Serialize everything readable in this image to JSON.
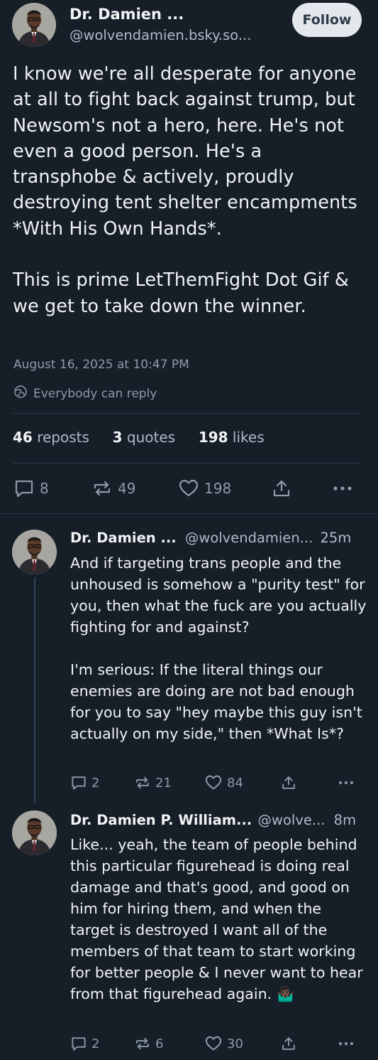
{
  "main_post": {
    "author_name": "Dr. Damien ...",
    "author_handle": "@wolvendamien.bsky.so...",
    "follow_label": "Follow",
    "text": "I know we're all desperate for anyone at all to fight back against trump, but Newsom's not a hero, here. He's not even a good person. He's a transphobe & actively, proudly destroying tent shelter encampments *With His Own Hands*.\n\nThis is prime LetThemFight Dot Gif & we get to take down the winner.",
    "timestamp": "August 16, 2025 at 10:47 PM",
    "reply_setting": "Everybody can reply",
    "reposts_count": "46",
    "reposts_label": "reposts",
    "quotes_count": "3",
    "quotes_label": "quotes",
    "likes_count": "198",
    "likes_label": "likes",
    "actions": {
      "replies": "8",
      "reposts": "49",
      "likes": "198"
    }
  },
  "replies": [
    {
      "author_name": "Dr. Damien ...",
      "author_handle": "@wolvendamien...",
      "time": "25m",
      "text": "And if targeting trans people and the unhoused is somehow a \"purity test\" for you, then what the fuck are you actually fighting for and against?\n\nI'm serious: If the literal things our enemies are doing are not bad enough for you to say \"hey maybe this guy isn't actually on my side,\" then *What Is*?",
      "actions": {
        "replies": "2",
        "reposts": "21",
        "likes": "84"
      }
    },
    {
      "author_name": "Dr. Damien P. William...",
      "author_handle": "@wolve...",
      "time": "8m",
      "text": "Like... yeah, the team of people behind this particular figurehead is doing real damage and that's good, and good on him for hiring them, and when the target is destroyed I want all of the members of that team to start working for better people & I never want to hear from that figurehead again. 🤷🏿‍♂️",
      "actions": {
        "replies": "2",
        "reposts": "6",
        "likes": "30"
      }
    }
  ],
  "icons": {
    "reply": "speech-bubble-icon",
    "repost": "repost-arrows-icon",
    "like": "heart-icon",
    "share": "share-icon",
    "more": "more-dots-icon",
    "reply_setting": "globe-icon"
  },
  "colors": {
    "background": "#161e27",
    "text": "#f1f3f5",
    "muted": "#8c9aa9",
    "follow_bg": "#e4e8ec",
    "thread_line": "#2c4762"
  }
}
